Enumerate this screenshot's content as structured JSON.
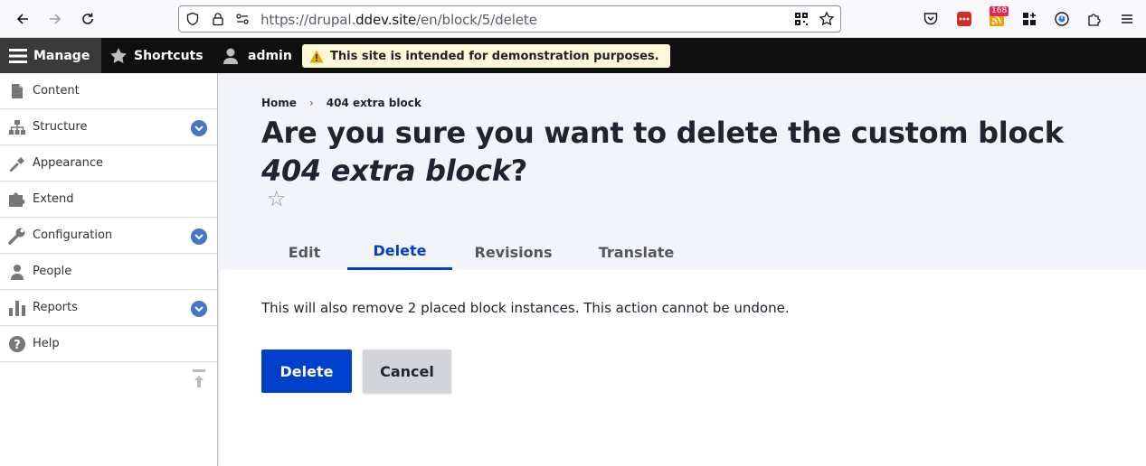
{
  "browser": {
    "url_prefix": "https://drupal.",
    "url_domain": "ddev.site",
    "url_path": "/en/block/5/delete",
    "badge_count": "168"
  },
  "toolbar": {
    "manage_label": "Manage",
    "shortcuts_label": "Shortcuts",
    "user_label": "admin",
    "notice_text": "This site is intended for demonstration purposes."
  },
  "sidebar": {
    "items": [
      {
        "label": "Content",
        "icon": "content-icon",
        "expandable": false
      },
      {
        "label": "Structure",
        "icon": "structure-icon",
        "expandable": true
      },
      {
        "label": "Appearance",
        "icon": "appearance-icon",
        "expandable": false
      },
      {
        "label": "Extend",
        "icon": "extend-icon",
        "expandable": false
      },
      {
        "label": "Configuration",
        "icon": "configuration-icon",
        "expandable": true
      },
      {
        "label": "People",
        "icon": "people-icon",
        "expandable": false
      },
      {
        "label": "Reports",
        "icon": "reports-icon",
        "expandable": true
      },
      {
        "label": "Help",
        "icon": "help-icon",
        "expandable": false
      }
    ]
  },
  "header": {
    "breadcrumb": [
      "Home",
      "404 extra block"
    ],
    "breadcrumb_separator": "›",
    "title_prefix": "Are you sure you want to delete the custom block ",
    "title_block_name": "404 extra block",
    "title_suffix": "?",
    "tabs": [
      {
        "label": "Edit",
        "active": false
      },
      {
        "label": "Delete",
        "active": true
      },
      {
        "label": "Revisions",
        "active": false
      },
      {
        "label": "Translate",
        "active": false
      }
    ]
  },
  "main": {
    "message": "This will also remove 2 placed block instances. This action cannot be undone.",
    "delete_label": "Delete",
    "cancel_label": "Cancel"
  },
  "colors": {
    "accent": "#003ecc",
    "toolbar_bg": "#0f0f0f",
    "notice_bg": "#fdf8d8",
    "chevron": "#4478c4"
  }
}
